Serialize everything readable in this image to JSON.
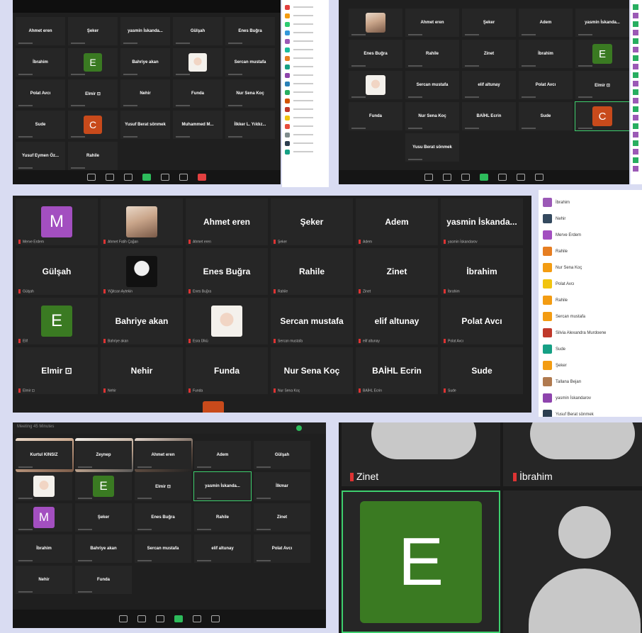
{
  "panel1": {
    "tiles": [
      {
        "name": "Ahmet eren"
      },
      {
        "name": "Şeker"
      },
      {
        "name": "yasmin İskanda..."
      },
      {
        "name": "Gülşah"
      },
      {
        "name": "Enes Buğra"
      },
      {
        "name": "İbrahim"
      },
      {
        "avatar": "E"
      },
      {
        "name": "Bahriye akan"
      },
      {
        "photo": "hijab"
      },
      {
        "name": "Sercan mustafa"
      },
      {
        "name": "Polat Avcı"
      },
      {
        "name": "Elmir ⊡"
      },
      {
        "name": "Nehir"
      },
      {
        "name": "Funda"
      },
      {
        "name": "Nur Sena Koç"
      },
      {
        "name": "Sude"
      },
      {
        "avatar": "C"
      },
      {
        "name": "Yusuf Berat sönmek"
      },
      {
        "name": "Muhammed M..."
      },
      {
        "name": "İlkker L. Yıldız..."
      },
      {
        "name": "Yusuf Eymen Öz..."
      },
      {
        "name": "Rahile"
      }
    ],
    "side_colors": [
      "#e24040",
      "#f39c12",
      "#2ecc71",
      "#3498db",
      "#9b59b6",
      "#1abc9c",
      "#e67e22",
      "#16a085",
      "#8e44ad",
      "#2980b9",
      "#27ae60",
      "#d35400",
      "#c0392b",
      "#f1c40f",
      "#e74c3c",
      "#7f8c8d",
      "#2c3e50",
      "#16a085"
    ]
  },
  "panel2": {
    "tiles": [
      {
        "photo": "plain"
      },
      {
        "name": "Ahmet eren"
      },
      {
        "name": "Şeker"
      },
      {
        "name": "Adem"
      },
      {
        "name": "yasmin İskanda..."
      },
      {
        "name": "Enes Buğra"
      },
      {
        "name": "Rahile"
      },
      {
        "name": "Zinet"
      },
      {
        "name": "İbrahim"
      },
      {
        "avatar": "E"
      },
      {
        "photo": "hijab"
      },
      {
        "name": "Sercan mustafa"
      },
      {
        "name": "elif altunay"
      },
      {
        "name": "Polat Avcı"
      },
      {
        "name": "Elmir ⊡"
      },
      {
        "name": "Funda"
      },
      {
        "name": "Nur Sena Koç"
      },
      {
        "name": "BAİHL Ecrin"
      },
      {
        "name": "Sude"
      },
      {
        "avatar": "C",
        "highlight": true
      },
      {
        "empty": true
      },
      {
        "name": "Yusu Berat sönmek"
      }
    ]
  },
  "panel3": {
    "tiles": [
      {
        "avatar": "M",
        "sub": "Merve Erdem"
      },
      {
        "photo": "plain",
        "sub": "Ahmet Fatih Çağan"
      },
      {
        "name": "Ahmet eren",
        "sub": "Ahmet eren"
      },
      {
        "name": "Şeker",
        "sub": "Şeker"
      },
      {
        "name": "Adem",
        "sub": "Adem"
      },
      {
        "name": "yasmin İskanda...",
        "sub": "yasmin İskandarov"
      },
      {
        "name": "Gülşah",
        "sub": "Gülşah"
      },
      {
        "photo": "dark",
        "sub": "Yiğitcan Aytekin"
      },
      {
        "name": "Enes Buğra",
        "sub": "Enes Buğra"
      },
      {
        "name": "Rahile",
        "sub": "Rahile"
      },
      {
        "name": "Zinet",
        "sub": "Zinet"
      },
      {
        "name": "İbrahim",
        "sub": "İbrahim"
      },
      {
        "avatar": "E",
        "sub": "Elif"
      },
      {
        "name": "Bahriye akan",
        "sub": "Bahriye akan"
      },
      {
        "photo": "hijab",
        "sub": "Esra Ülkü"
      },
      {
        "name": "Sercan mustafa",
        "sub": "Sercan mustafa"
      },
      {
        "name": "elif altunay",
        "sub": "elif altunay"
      },
      {
        "name": "Polat Avcı",
        "sub": "Polat Avcı"
      },
      {
        "name": "Elmir ⊡",
        "sub": "Elmir ⊡"
      },
      {
        "name": "Nehir",
        "sub": "Nehir"
      },
      {
        "name": "Funda",
        "sub": "Funda"
      },
      {
        "name": "Nur Sena Koç",
        "sub": "Nur Sena Koç"
      },
      {
        "name": "BAİHL Ecrin",
        "sub": "BAİHL Ecrin"
      },
      {
        "name": "Sude",
        "sub": "Sude"
      }
    ],
    "side_list": [
      {
        "label": "İbrahim",
        "color": "#9b59b6"
      },
      {
        "label": "Nehir",
        "color": "#34495e"
      },
      {
        "label": "Merve Erdem",
        "color": "#a34fc0"
      },
      {
        "label": "Rahile",
        "color": "#e67e22"
      },
      {
        "label": "Nur Sena Koç",
        "color": "#f39c12"
      },
      {
        "label": "Polat Avcı",
        "color": "#f1c40f"
      },
      {
        "label": "Rahile",
        "color": "#f39c12"
      },
      {
        "label": "Sercan mustafa",
        "color": "#f39c12"
      },
      {
        "label": "Silvia Alexandra Murdoene",
        "color": "#c0392b"
      },
      {
        "label": "Sude",
        "color": "#16a085"
      },
      {
        "label": "Şeker",
        "color": "#f39c12"
      },
      {
        "label": "Tallana Bejan",
        "color": "#b07a4f"
      },
      {
        "label": "yasmin İskandarov",
        "color": "#8e44ad"
      },
      {
        "label": "Yusuf Berat sönmek",
        "color": "#2c3e50"
      }
    ]
  },
  "panel4": {
    "title": "Meeting 45 Minutes",
    "tiles": [
      {
        "name": "Kurtul KINSIZ"
      },
      {
        "name": "Zeynep"
      },
      {
        "name": "Ahmet eren"
      },
      {
        "name": "Adem"
      },
      {
        "name": "Gülşah"
      },
      {
        "photo": "hijab"
      },
      {
        "avatar": "E"
      },
      {
        "name": "Elmir ⊡"
      },
      {
        "name": "yasmin İskanda...",
        "highlight": true
      },
      {
        "name": "İlkmar"
      },
      {
        "avatar": "M"
      },
      {
        "name": "Şeker"
      },
      {
        "name": "Enes Buğra"
      },
      {
        "name": "Rahile"
      },
      {
        "name": "Zinet"
      },
      {
        "name": "İbrahim"
      },
      {
        "name": "Bahriye akan"
      },
      {
        "name": "Sercan mustafa"
      },
      {
        "name": "elif altunay"
      },
      {
        "name": "Polat Avcı"
      },
      {
        "name": "Nehir"
      },
      {
        "name": "Funda"
      }
    ]
  },
  "panel5": {
    "label_left": "Zinet",
    "label_right": "İbrahim",
    "big_letter": "E"
  }
}
